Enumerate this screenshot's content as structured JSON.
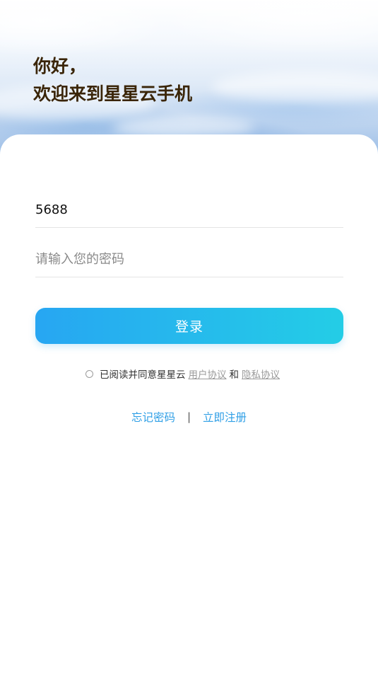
{
  "greeting": {
    "line1": "你好，",
    "line2": "欢迎来到星星云手机"
  },
  "form": {
    "phone_value": "5688",
    "password_placeholder": "请输入您的密码",
    "login_label": "登录"
  },
  "agreement": {
    "prefix": "已阅读并同意星星云",
    "user_agreement": "用户协议",
    "and": "和",
    "privacy_policy": "隐私协议",
    "checked": false
  },
  "links": {
    "forgot_password": "忘记密码",
    "divider": "|",
    "register": "立即注册"
  },
  "colors": {
    "accent_start": "#27a6f2",
    "accent_end": "#24cde6",
    "link": "#2f9fe6",
    "greeting_text": "#3a2508"
  }
}
